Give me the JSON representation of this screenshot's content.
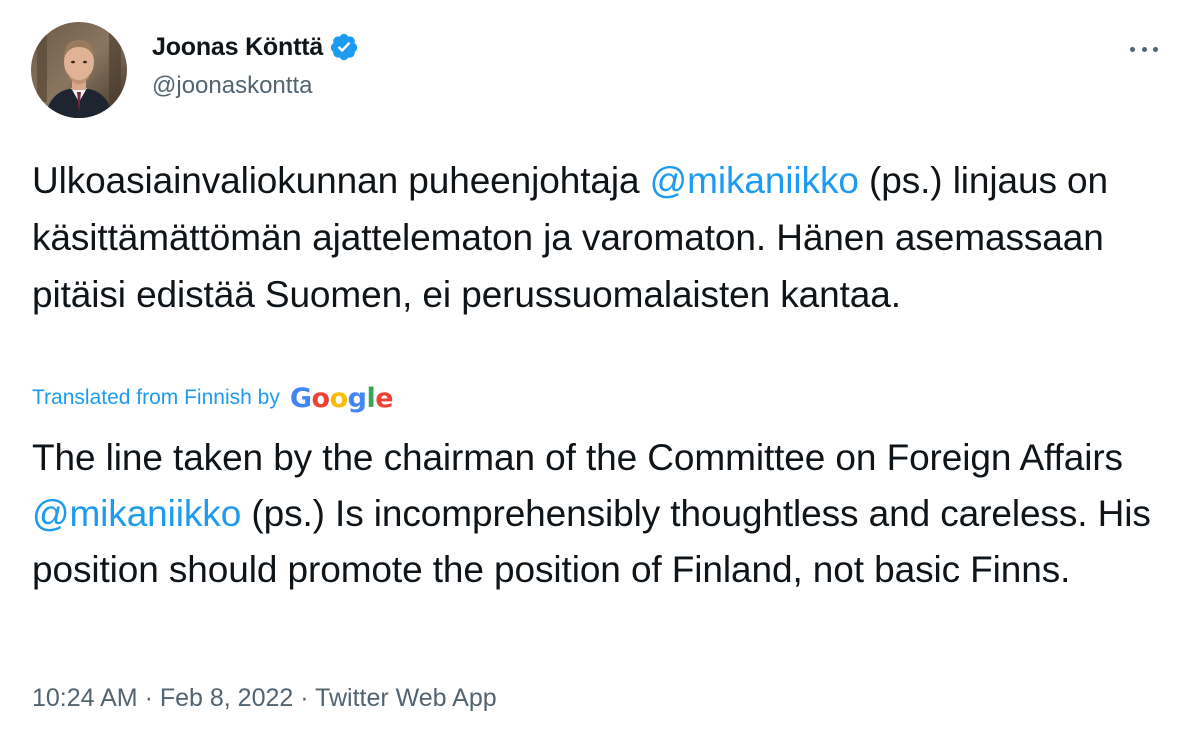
{
  "author": {
    "name": "Joonas Könttä",
    "handle": "@joonaskontta",
    "verified": true
  },
  "tweet": {
    "original": {
      "part1": "Ulkoasiainvaliokunnan puheenjohtaja ",
      "mention": "@mikaniikko",
      "part2": " (ps.) linjaus on käsittämättömän ajattelematon ja varomaton. Hänen asemassaan pitäisi edistää Suomen, ei perussuomalaisten kantaa."
    },
    "translation_label": "Translated from Finnish by",
    "translation_provider": "Google",
    "translation": {
      "part1": "The line taken by the chairman of the Committee on Foreign Affairs ",
      "mention": "@mikaniikko",
      "part2": " (ps.) Is incomprehensibly thoughtless and careless. His position should promote the position of Finland, not basic Finns."
    }
  },
  "meta": {
    "time": "10:24 AM",
    "separator": " · ",
    "date": "Feb 8, 2022",
    "source": "Twitter Web App"
  },
  "colors": {
    "accent": "#1d9bf0",
    "text": "#0f1419",
    "secondary": "#536471"
  },
  "icons": {
    "verified": "verified-badge-icon",
    "more": "more-options-icon"
  }
}
